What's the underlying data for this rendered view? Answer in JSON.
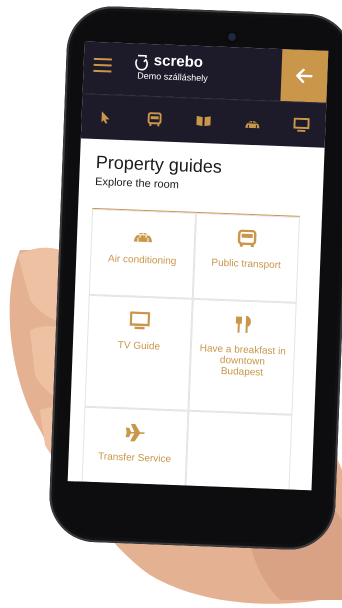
{
  "app": {
    "brand_name": "screbo",
    "brand_subtitle": "Demo szálláshely"
  },
  "nav_icons": [
    "pointer-icon",
    "bus-icon",
    "book-icon",
    "igloo-icon",
    "monitor-icon"
  ],
  "page": {
    "title": "Property guides",
    "subtitle": "Explore the room"
  },
  "guides": [
    {
      "label": "Air conditioning",
      "icon": "igloo-icon"
    },
    {
      "label": "Public transport",
      "icon": "bus-icon"
    },
    {
      "label": "TV Guide",
      "icon": "tv-icon"
    },
    {
      "label": "Have a breakfast in downtown Budapest",
      "icon": "cutlery-icon"
    },
    {
      "label": "Transfer Service",
      "icon": "plane-icon"
    }
  ],
  "colors": {
    "accent": "#c9964a",
    "appbar": "#1d1a2a",
    "text": "#1a1a1a"
  }
}
